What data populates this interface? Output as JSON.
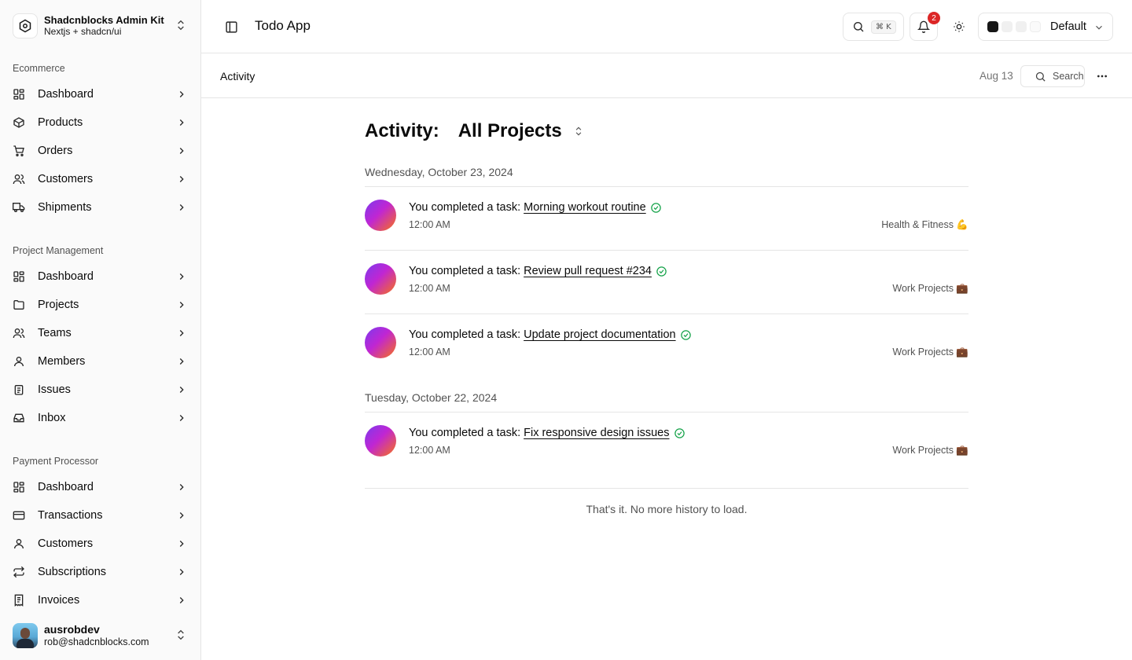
{
  "sidebar": {
    "brand": {
      "title": "Shadcnblocks Admin Kit",
      "subtitle": "Nextjs + shadcn/ui"
    },
    "groups": [
      {
        "label": "Ecommerce",
        "items": [
          {
            "label": "Dashboard",
            "icon": "layout-dashboard-icon"
          },
          {
            "label": "Products",
            "icon": "package-icon"
          },
          {
            "label": "Orders",
            "icon": "shopping-cart-icon"
          },
          {
            "label": "Customers",
            "icon": "users-icon"
          },
          {
            "label": "Shipments",
            "icon": "truck-icon"
          }
        ]
      },
      {
        "label": "Project Management",
        "items": [
          {
            "label": "Dashboard",
            "icon": "layout-dashboard-icon"
          },
          {
            "label": "Projects",
            "icon": "folder-icon"
          },
          {
            "label": "Teams",
            "icon": "users-icon"
          },
          {
            "label": "Members",
            "icon": "user-icon"
          },
          {
            "label": "Issues",
            "icon": "clipboard-icon"
          },
          {
            "label": "Inbox",
            "icon": "inbox-icon"
          }
        ]
      },
      {
        "label": "Payment Processor",
        "items": [
          {
            "label": "Dashboard",
            "icon": "layout-dashboard-icon"
          },
          {
            "label": "Transactions",
            "icon": "credit-card-icon"
          },
          {
            "label": "Customers",
            "icon": "user-icon"
          },
          {
            "label": "Subscriptions",
            "icon": "repeat-icon"
          },
          {
            "label": "Invoices",
            "icon": "receipt-icon"
          }
        ]
      }
    ],
    "user": {
      "name": "ausrobdev",
      "email": "rob@shadcnblocks.com"
    }
  },
  "topbar": {
    "app_title": "Todo App",
    "search_shortcut": "⌘ K",
    "notification_count": "2",
    "theme_label": "Default"
  },
  "subbar": {
    "title": "Activity",
    "date": "Aug 13",
    "search_label": "Search"
  },
  "main": {
    "heading": "Activity:",
    "project_filter": "All Projects",
    "sections": [
      {
        "date": "Wednesday, October 23, 2024",
        "activities": [
          {
            "actor": "You",
            "verb": "completed a task:",
            "task": "Morning workout routine",
            "time": "12:00 AM",
            "project": "Health & Fitness 💪"
          },
          {
            "actor": "You",
            "verb": "completed a task:",
            "task": "Review pull request #234",
            "time": "12:00 AM",
            "project": "Work Projects 💼"
          },
          {
            "actor": "You",
            "verb": "completed a task:",
            "task": "Update project documentation",
            "time": "12:00 AM",
            "project": "Work Projects 💼"
          }
        ]
      },
      {
        "date": "Tuesday, October 22, 2024",
        "activities": [
          {
            "actor": "You",
            "verb": "completed a task:",
            "task": "Fix responsive design issues",
            "time": "12:00 AM",
            "project": "Work Projects 💼"
          }
        ]
      }
    ],
    "end_message": "That's it. No more history to load."
  },
  "colors": {
    "border": "#e5e5e5",
    "muted_text": "#525252",
    "success": "#16a34a",
    "badge": "#dc2626",
    "avatar_gradient": [
      "#7c3aed",
      "#c026d3",
      "#f97316"
    ]
  }
}
